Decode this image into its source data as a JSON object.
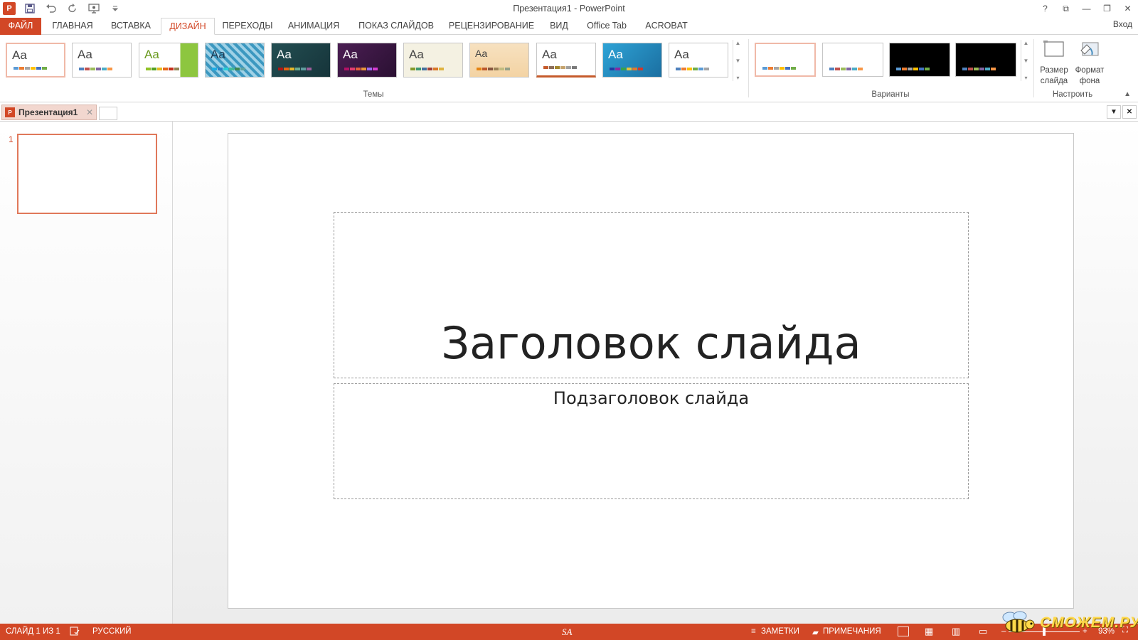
{
  "window": {
    "title": "Презентация1 - PowerPoint",
    "app_logo": "P",
    "controls": [
      "?",
      "⧉",
      "—",
      "❐",
      "✕"
    ]
  },
  "qat": {
    "icons": [
      "save-icon",
      "undo-icon",
      "redo-icon",
      "present-icon",
      "customize-icon"
    ]
  },
  "tabs": {
    "file": "ФАЙЛ",
    "items": [
      "ГЛАВНАЯ",
      "ВСТАВКА",
      "ДИЗАЙН",
      "ПЕРЕХОДЫ",
      "АНИМАЦИЯ",
      "ПОКАЗ СЛАЙДОВ",
      "РЕЦЕНЗИРОВАНИЕ",
      "ВИД",
      "Office Tab",
      "ACROBAT"
    ],
    "active": "ДИЗАЙН",
    "signin": "Вход"
  },
  "ribbon": {
    "themes_label": "Темы",
    "variants_label": "Варианты",
    "customize_label": "Настроить",
    "theme_sample": "Aa",
    "slide_size": "Размер слайда",
    "format_background": "Формат фона",
    "colors": {
      "accent": "#d24726"
    }
  },
  "document": {
    "tab_name": "Презентация1"
  },
  "thumbnails": {
    "slide_number": "1"
  },
  "slide": {
    "title": "Заголовок слайда",
    "subtitle": "Подзаголовок слайда"
  },
  "statusbar": {
    "slide_info": "СЛАЙД 1 ИЗ 1",
    "language": "РУССКИЙ",
    "notes": "ЗАМЕТКИ",
    "comments": "ПРИМЕЧАНИЯ",
    "zoom": "93%",
    "center_mark": "SA"
  },
  "watermark": {
    "text": "СМОЖЕМ.РУ"
  }
}
